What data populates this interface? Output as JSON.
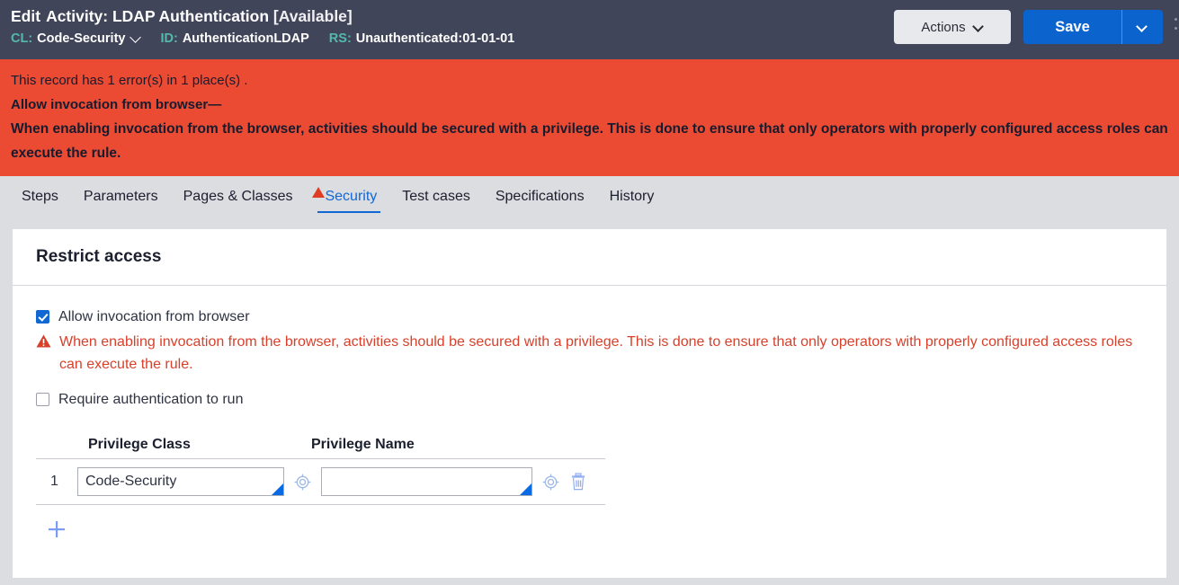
{
  "header": {
    "title_prefix": "Edit",
    "title_type": "Activity:",
    "title_name": "LDAP Authentication",
    "title_status": "[Available]",
    "meta": [
      {
        "label": "CL:",
        "value": "Code-Security",
        "has_caret": true
      },
      {
        "label": "ID:",
        "value": "AuthenticationLDAP",
        "has_caret": false
      },
      {
        "label": "RS:",
        "value": "Unauthenticated:01-01-01",
        "has_caret": false
      }
    ],
    "actions_label": "Actions",
    "save_label": "Save",
    "colors": {
      "header_bg": "#414559",
      "accent_teal": "#54b9ad",
      "primary_blue": "#0b63ce"
    }
  },
  "error_banner": {
    "summary": "This record has 1 error(s) in 1 place(s) .",
    "field": "Allow invocation from browser—",
    "message": "When enabling invocation from the browser, activities should be secured with a privilege. This is done to ensure that only operators with properly configured access roles can execute the rule.",
    "background": "#ec4b33"
  },
  "tabs": [
    {
      "label": "Steps",
      "active": false,
      "warning": false
    },
    {
      "label": "Parameters",
      "active": false,
      "warning": false
    },
    {
      "label": "Pages & Classes",
      "active": false,
      "warning": false
    },
    {
      "label": "Security",
      "active": true,
      "warning": true
    },
    {
      "label": "Test cases",
      "active": false,
      "warning": false
    },
    {
      "label": "Specifications",
      "active": false,
      "warning": false
    },
    {
      "label": "History",
      "active": false,
      "warning": false
    }
  ],
  "card": {
    "title": "Restrict access",
    "checkbox_browser": {
      "label": "Allow invocation from browser",
      "checked": true
    },
    "inline_warning": "When enabling invocation from the browser, activities should be secured with a privilege. This is done to ensure that only operators with properly configured access roles can execute the rule.",
    "checkbox_auth": {
      "label": "Require authentication to run",
      "checked": false
    },
    "table": {
      "columns": [
        "Privilege Class",
        "Privilege Name"
      ],
      "rows": [
        {
          "num": "1",
          "privilege_class": "Code-Security",
          "privilege_name": "",
          "privilege_name_placeholder": ""
        }
      ]
    },
    "add_row_label": "+"
  }
}
